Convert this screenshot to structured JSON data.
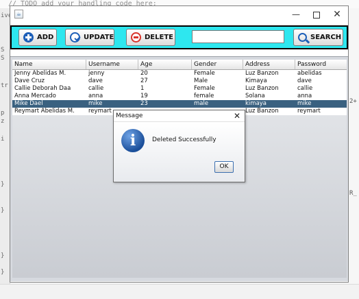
{
  "ide": {
    "top_text": "// TODO add your handling code here:",
    "gutter": [
      "ive",
      "S",
      "S",
      "tr",
      "p",
      "z",
      "i",
      "}",
      "}",
      "}",
      "}"
    ],
    "right_fragments": [
      "2+",
      "R_"
    ]
  },
  "window": {
    "min_glyph": "—",
    "close_glyph": "✕"
  },
  "toolbar": {
    "add_label": "ADD",
    "update_label": "UPDATE",
    "delete_label": "DELETE",
    "search_label": "SEARCH",
    "search_value": ""
  },
  "table": {
    "columns": [
      "Name",
      "Username",
      "Age",
      "Gender",
      "Address",
      "Password"
    ],
    "rows": [
      [
        "Jenny Abelidas M.",
        "jenny",
        "20",
        "Female",
        "Luz Banzon",
        "abelidas"
      ],
      [
        "Dave Cruz",
        "dave",
        "27",
        "Male",
        "Kimaya",
        "dave"
      ],
      [
        "Callie Deborah Daa",
        "callie",
        "1",
        "Female",
        "Luz Banzon",
        "callie"
      ],
      [
        "Anna Mercado",
        "anna",
        "19",
        "female",
        "Solana",
        "anna"
      ],
      [
        "Mike Dael",
        "mike",
        "23",
        "male",
        "kimaya",
        "mike"
      ],
      [
        "Reymart Abelidas M.",
        "reymart",
        "",
        "",
        "Luz Banzon",
        "reymart"
      ]
    ],
    "selected_row": 4
  },
  "dialog": {
    "title": "Message",
    "close_glyph": "✕",
    "message": "Deleted Successfully",
    "ok_label": "OK",
    "icon_glyph": "i"
  }
}
